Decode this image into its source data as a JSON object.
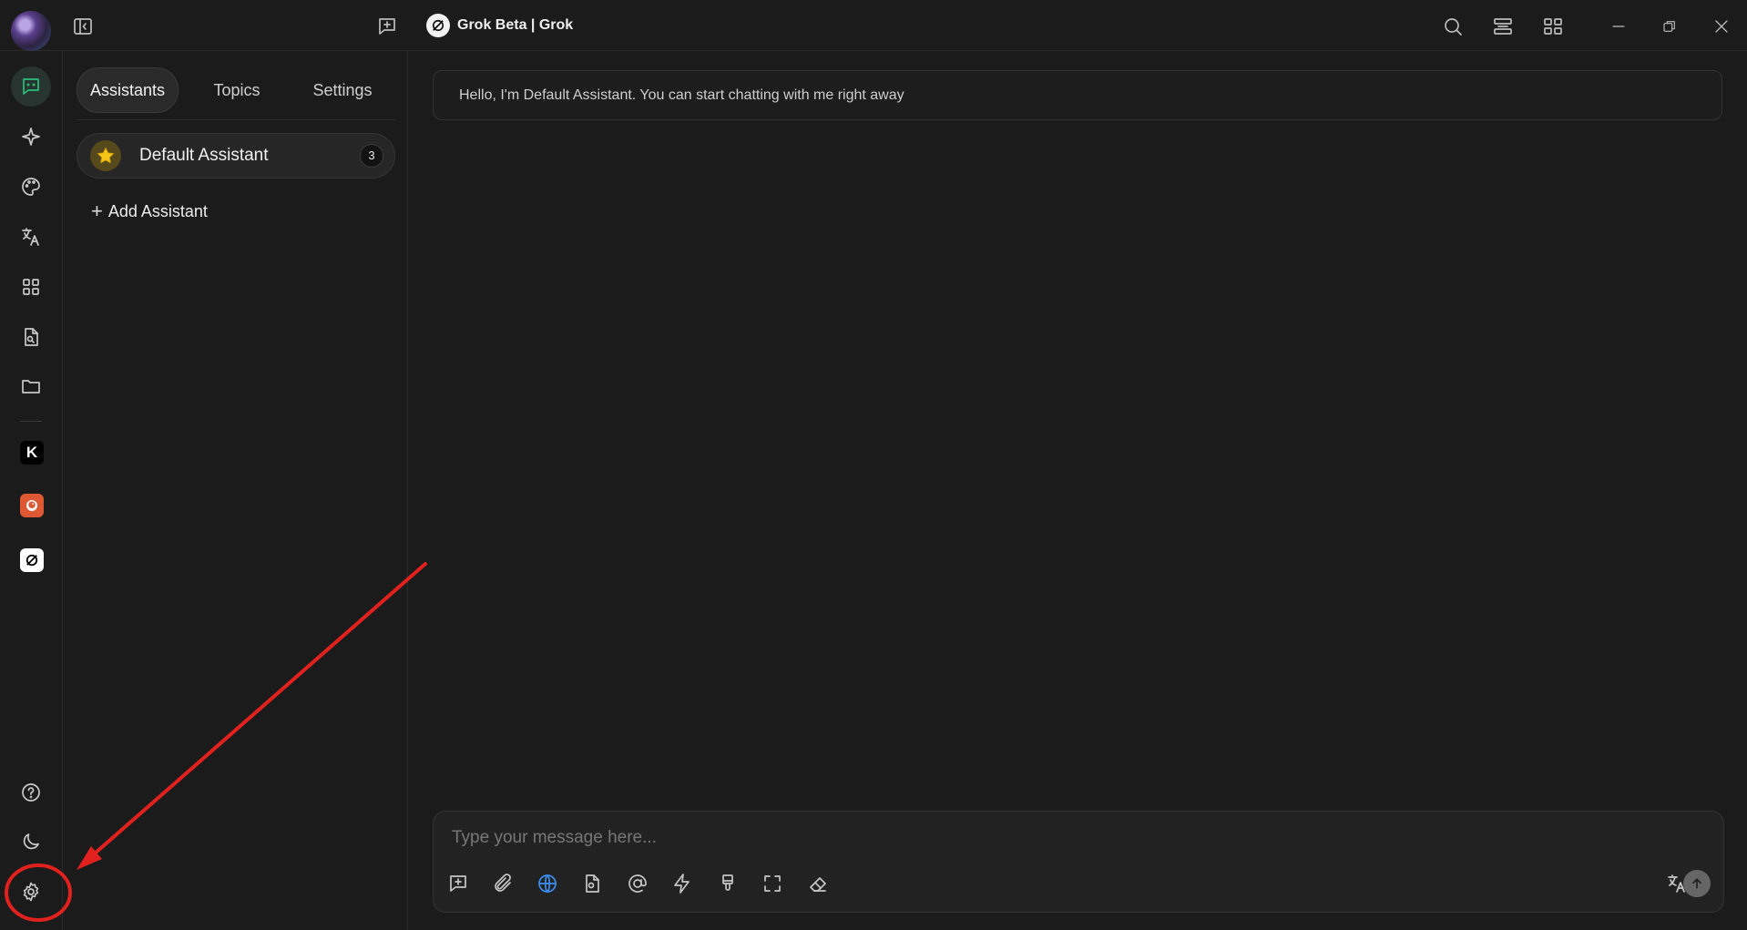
{
  "window": {
    "title": "Grok Beta | Grok"
  },
  "topbar": {
    "icons": [
      "sidebar-toggle-icon",
      "new-topic-icon",
      "search-icon",
      "layout-icon",
      "apps-icon",
      "minimize-icon",
      "restore-icon",
      "close-icon"
    ]
  },
  "rail": {
    "items": [
      {
        "name": "chat",
        "icon": "chat-icon",
        "active": true
      },
      {
        "name": "agents",
        "icon": "sparkle-icon"
      },
      {
        "name": "paintings",
        "icon": "palette-icon"
      },
      {
        "name": "translate",
        "icon": "translate-icon"
      },
      {
        "name": "mini-apps",
        "icon": "grid-icon"
      },
      {
        "name": "knowledge",
        "icon": "file-search-icon"
      },
      {
        "name": "files",
        "icon": "folder-icon"
      }
    ],
    "pinned_apps": [
      {
        "name": "kimi",
        "label": "K",
        "color": "#000000"
      },
      {
        "name": "duckduckgo",
        "label": "",
        "color": "#de5833"
      },
      {
        "name": "grok",
        "label": "",
        "color": "#ffffff"
      }
    ],
    "bottom": [
      "help-icon",
      "theme-moon-icon",
      "settings-gear-icon"
    ]
  },
  "panel": {
    "tabs": [
      {
        "label": "Assistants",
        "active": true
      },
      {
        "label": "Topics"
      },
      {
        "label": "Settings"
      }
    ],
    "assistants": [
      {
        "name": "Default Assistant",
        "count": "3",
        "icon": "star-icon"
      }
    ],
    "add_label": "Add Assistant"
  },
  "chat": {
    "welcome": "Hello, I'm Default Assistant. You can start chatting with me right away",
    "input_placeholder": "Type your message here...",
    "toolbar_icons": [
      "new-topic-icon",
      "paperclip-icon",
      "globe-icon",
      "file-icon",
      "at-mention-icon",
      "lightning-icon",
      "brush-icon",
      "fullscreen-icon",
      "eraser-icon"
    ],
    "accent_color": "#3b8df2"
  },
  "annotation": {
    "color": "#e0211d",
    "target": "settings-gear-icon"
  }
}
